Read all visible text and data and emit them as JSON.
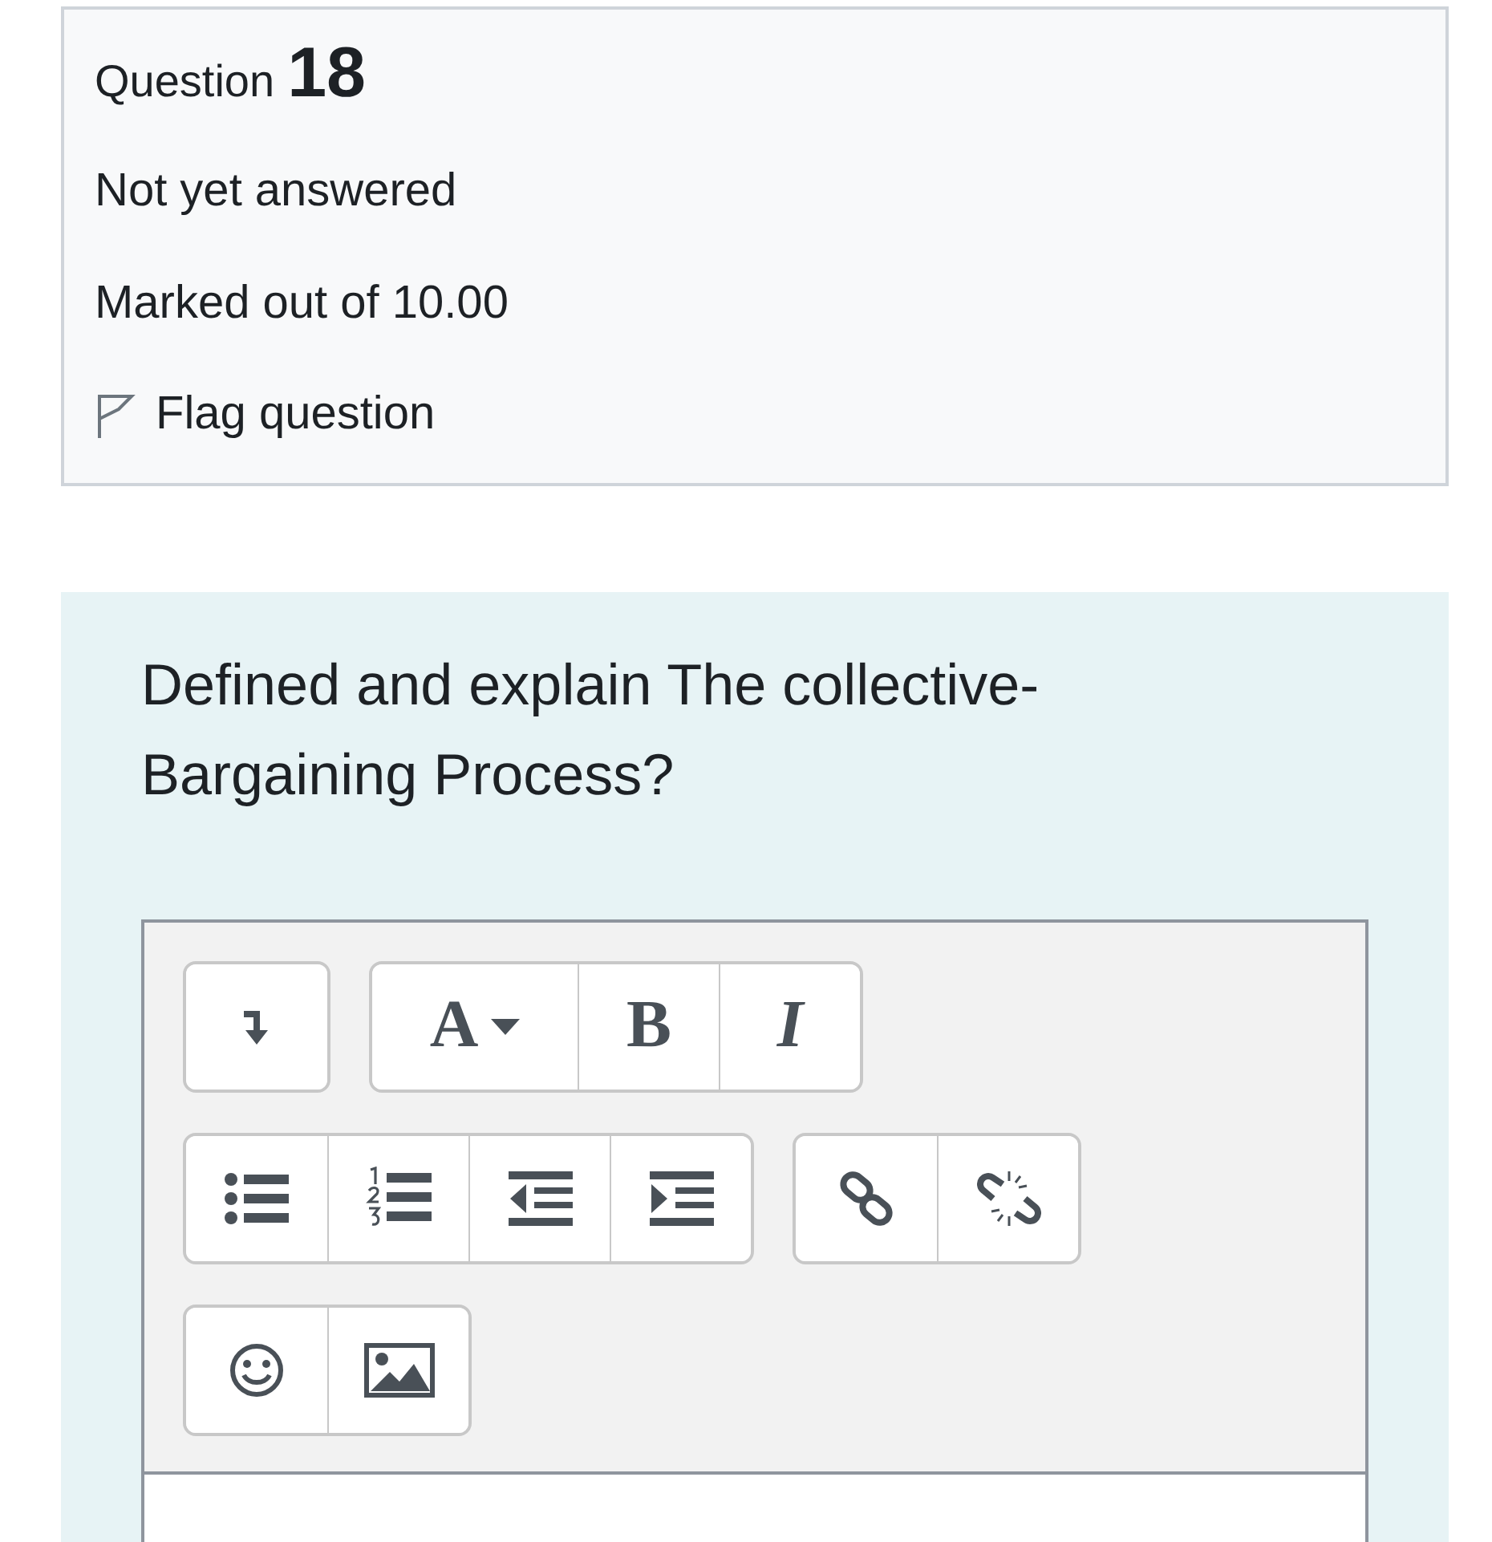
{
  "info": {
    "question_label": "Question",
    "question_number": "18",
    "status": "Not yet answered",
    "marks": "Marked out of 10.00",
    "flag": {
      "label": "Flag question",
      "flagged": false
    }
  },
  "question_text": "Defined and explain The collective-Bargaining Process?",
  "toolbar": [
    [
      [
        {
          "kind": "expand"
        }
      ],
      [
        {
          "kind": "font",
          "label": "A"
        },
        {
          "kind": "bold",
          "label": "B"
        },
        {
          "kind": "italic",
          "label": "I"
        }
      ]
    ],
    [
      [
        {
          "kind": "bullets"
        },
        {
          "kind": "numbers"
        },
        {
          "kind": "outdent"
        },
        {
          "kind": "indent"
        }
      ],
      [
        {
          "kind": "link"
        },
        {
          "kind": "unlink"
        }
      ]
    ],
    [
      [
        {
          "kind": "emoji"
        },
        {
          "kind": "image"
        }
      ]
    ]
  ]
}
